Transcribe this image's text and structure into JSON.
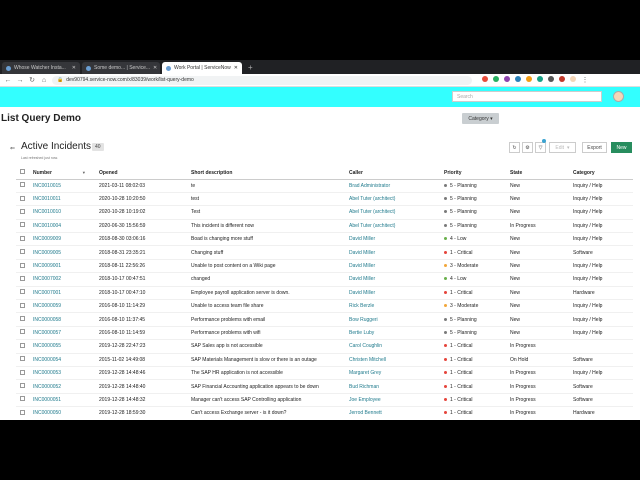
{
  "browser": {
    "tabs": [
      {
        "label": "Whose Watcher Insta...",
        "active": false
      },
      {
        "label": "Some demo... | Service...",
        "active": false
      },
      {
        "label": "Work Portal | ServiceNow",
        "active": true
      }
    ],
    "url": "dev90794.service-now.com/x/83039/work/list-query-demo"
  },
  "app": {
    "search_placeholder": "Search",
    "page_title": "List Query Demo",
    "category_button": "Category ▾"
  },
  "list": {
    "title": "Active Incidents",
    "count": "40",
    "refreshed": "Last refreshed just now.",
    "edit_label": "Edit",
    "export_label": "Export",
    "new_label": "New",
    "columns": [
      "Number",
      "Opened",
      "Short description",
      "Caller",
      "Priority",
      "State",
      "Category"
    ],
    "rows": [
      {
        "number": "INC0010015",
        "opened": "2021-03-11 08:02:03",
        "short": "te",
        "caller": "Brad Administrator",
        "priority": "5 - Planning",
        "state": "New",
        "category": "Inquiry / Help"
      },
      {
        "number": "INC0010011",
        "opened": "2020-10-28 10:20:50",
        "short": "test",
        "caller": "Abel Tuter (architect)",
        "priority": "5 - Planning",
        "state": "New",
        "category": "Inquiry / Help"
      },
      {
        "number": "INC0010010",
        "opened": "2020-10-28 10:19:02",
        "short": "Test",
        "caller": "Abel Tuter (architect)",
        "priority": "5 - Planning",
        "state": "New",
        "category": "Inquiry / Help"
      },
      {
        "number": "INC0010004",
        "opened": "2020-06-30 15:56:59",
        "short": "This incident is different now",
        "caller": "Abel Tuter (architect)",
        "priority": "5 - Planning",
        "state": "In Progress",
        "category": "Inquiry / Help"
      },
      {
        "number": "INC0009009",
        "opened": "2018-08-30 03:06:16",
        "short": "Boad is changing more stuff",
        "caller": "David Miller",
        "priority": "4 - Low",
        "state": "New",
        "category": "Inquiry / Help"
      },
      {
        "number": "INC0009005",
        "opened": "2018-08-31 23:35:21",
        "short": "Changing stuff",
        "caller": "David Miller",
        "priority": "1 - Critical",
        "state": "New",
        "category": "Software"
      },
      {
        "number": "INC0009001",
        "opened": "2018-08-11 22:56:26",
        "short": "Unable to post content on a Wiki page",
        "caller": "David Miller",
        "priority": "3 - Moderate",
        "state": "New",
        "category": "Inquiry / Help"
      },
      {
        "number": "INC0007002",
        "opened": "2018-10-17 00:47:51",
        "short": "changed",
        "caller": "David Miller",
        "priority": "4 - Low",
        "state": "New",
        "category": "Inquiry / Help"
      },
      {
        "number": "INC0007001",
        "opened": "2018-10-17 00:47:10",
        "short": "Employee payroll application server is down.",
        "caller": "David Miller",
        "priority": "1 - Critical",
        "state": "New",
        "category": "Hardware"
      },
      {
        "number": "INC0000059",
        "opened": "2016-08-10 11:14:29",
        "short": "Unable to access team file share",
        "caller": "Rick Berzle",
        "priority": "3 - Moderate",
        "state": "New",
        "category": "Inquiry / Help"
      },
      {
        "number": "INC0000058",
        "opened": "2016-08-10 11:37:45",
        "short": "Performance problems with email",
        "caller": "Bow Ruggeri",
        "priority": "5 - Planning",
        "state": "New",
        "category": "Inquiry / Help"
      },
      {
        "number": "INC0000057",
        "opened": "2016-08-10 11:14:59",
        "short": "Performance problems with wifi",
        "caller": "Bertie Luby",
        "priority": "5 - Planning",
        "state": "New",
        "category": "Inquiry / Help"
      },
      {
        "number": "INC0000055",
        "opened": "2019-12-28 22:47:23",
        "short": "SAP Sales app is not accessible",
        "caller": "Carol Coughlin",
        "priority": "1 - Critical",
        "state": "In Progress",
        "category": ""
      },
      {
        "number": "INC0000054",
        "opened": "2015-11-02 14:49:08",
        "short": "SAP Materials Management is slow or there is an outage",
        "caller": "Christen Mitchell",
        "priority": "1 - Critical",
        "state": "On Hold",
        "category": "Software"
      },
      {
        "number": "INC0000053",
        "opened": "2019-12-28 14:48:46",
        "short": "The SAP HR application is not accessible",
        "caller": "Margaret Grey",
        "priority": "1 - Critical",
        "state": "In Progress",
        "category": "Inquiry / Help"
      },
      {
        "number": "INC0000052",
        "opened": "2019-12-28 14:48:40",
        "short": "SAP Financial Accounting application appears to be down",
        "caller": "Bud Richman",
        "priority": "1 - Critical",
        "state": "In Progress",
        "category": "Software"
      },
      {
        "number": "INC0000051",
        "opened": "2019-12-28 14:48:32",
        "short": "Manager can't access SAP Controlling application",
        "caller": "Joe Employee",
        "priority": "1 - Critical",
        "state": "In Progress",
        "category": "Software"
      },
      {
        "number": "INC0000050",
        "opened": "2019-12-28 18:59:30",
        "short": "Can't access Exchange server - is it down?",
        "caller": "Jerrod Bennett",
        "priority": "1 - Critical",
        "state": "In Progress",
        "category": "Hardware"
      }
    ]
  },
  "colors": {
    "header_bg": "#33ffff",
    "link": "#1f7a8c",
    "new_button": "#278d5e",
    "critical": "#e5443b",
    "moderate": "#f2a63a",
    "low": "#6ab04c",
    "planning": "#7a7a7a"
  }
}
